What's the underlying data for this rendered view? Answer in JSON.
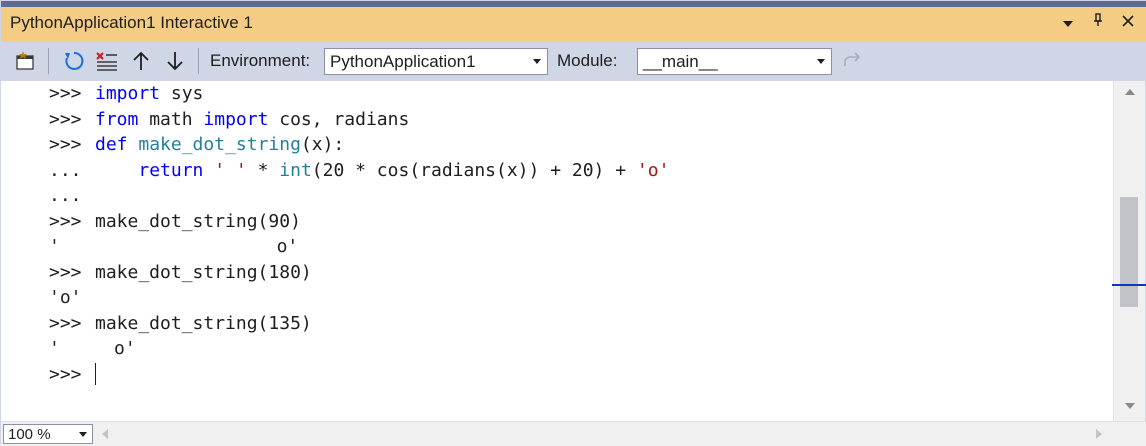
{
  "window": {
    "title": "PythonApplication1 Interactive 1",
    "title_icons": [
      "dropdown-icon",
      "pin-icon",
      "close-icon"
    ]
  },
  "toolbar": {
    "environment_label": "Environment:",
    "environment_value": "PythonApplication1",
    "module_label": "Module:",
    "module_value": "__main__",
    "buttons": [
      "send-to-interactive-icon",
      "reset-icon",
      "clear-icon",
      "history-up-icon",
      "history-down-icon",
      "redo-icon"
    ]
  },
  "console": {
    "lines": [
      {
        "prompt": ">>>",
        "parts": [
          {
            "t": "import",
            "c": "kw"
          },
          {
            "t": " sys",
            "c": ""
          }
        ]
      },
      {
        "prompt": ">>>",
        "parts": [
          {
            "t": "from",
            "c": "kw"
          },
          {
            "t": " math ",
            "c": ""
          },
          {
            "t": "import",
            "c": "kw"
          },
          {
            "t": " cos, radians",
            "c": ""
          }
        ]
      },
      {
        "prompt": ">>>",
        "parts": [
          {
            "t": "def",
            "c": "kw"
          },
          {
            "t": " ",
            "c": ""
          },
          {
            "t": "make_dot_string",
            "c": "fn"
          },
          {
            "t": "(x):",
            "c": ""
          }
        ]
      },
      {
        "prompt": "...",
        "parts": [
          {
            "t": "    ",
            "c": ""
          },
          {
            "t": "return",
            "c": "kw"
          },
          {
            "t": " ",
            "c": ""
          },
          {
            "t": "' '",
            "c": "str"
          },
          {
            "t": " * ",
            "c": ""
          },
          {
            "t": "int",
            "c": "fn"
          },
          {
            "t": "(20 * cos(radians(x)) + 20) + ",
            "c": ""
          },
          {
            "t": "'o'",
            "c": "str"
          }
        ]
      },
      {
        "prompt": "...",
        "parts": []
      },
      {
        "prompt": ">>>",
        "parts": [
          {
            "t": "make_dot_string(90)",
            "c": ""
          }
        ]
      },
      {
        "prompt": "",
        "output": "'                    o'"
      },
      {
        "prompt": ">>>",
        "parts": [
          {
            "t": "make_dot_string(180)",
            "c": ""
          }
        ]
      },
      {
        "prompt": "",
        "output": "'o'"
      },
      {
        "prompt": ">>>",
        "parts": [
          {
            "t": "make_dot_string(135)",
            "c": ""
          }
        ]
      },
      {
        "prompt": "",
        "output": "'     o'"
      },
      {
        "prompt": ">>>",
        "parts": []
      }
    ]
  },
  "status": {
    "zoom": "100 %"
  },
  "colors": {
    "title_bg": "#f5cc84",
    "toolbar_bg": "#cfd6e5",
    "keyword": "#0000ff",
    "function": "#267f99",
    "string": "#a31515"
  }
}
